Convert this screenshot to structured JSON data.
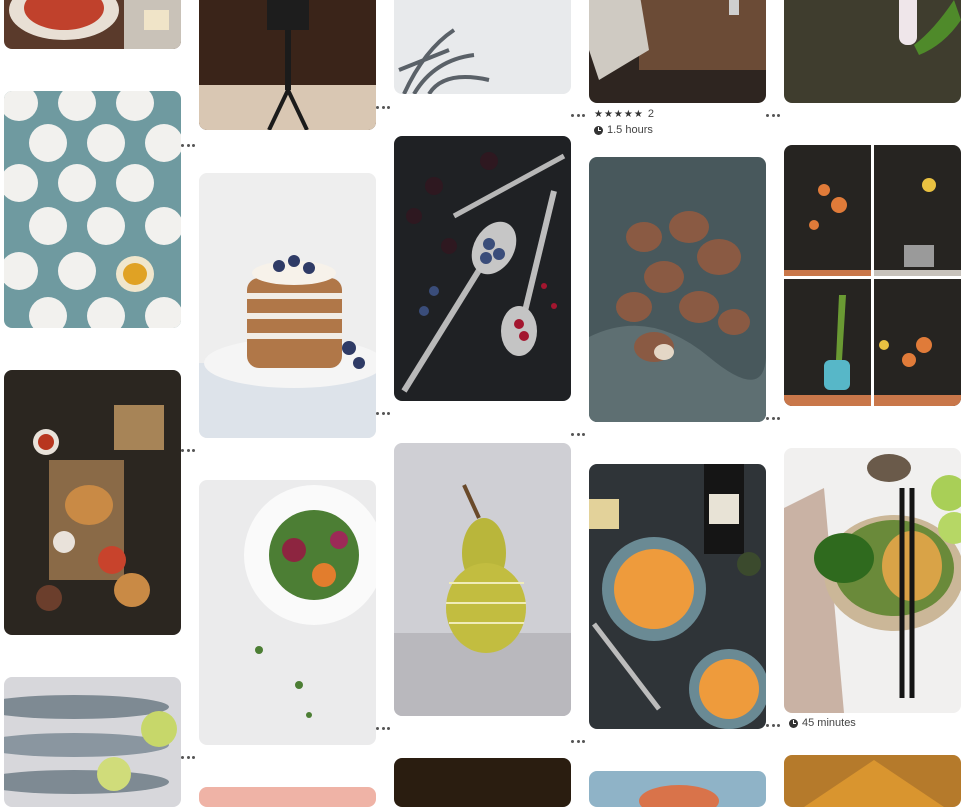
{
  "pins": [
    {
      "id": "p1",
      "name": "pasta-pin",
      "icon": "pasta-photo-icon"
    },
    {
      "id": "p2",
      "name": "eggs-pin",
      "icon": "eggs-photo-icon"
    },
    {
      "id": "p3",
      "name": "burger-pin",
      "icon": "burger-photo-icon"
    },
    {
      "id": "p4",
      "name": "fish-pin",
      "icon": "fish-photo-icon"
    },
    {
      "id": "p5",
      "name": "camera-pin",
      "icon": "camera-photo-icon"
    },
    {
      "id": "p6",
      "name": "pancakes-pin",
      "icon": "pancakes-photo-icon"
    },
    {
      "id": "p7",
      "name": "salad-pin",
      "icon": "salad-photo-icon"
    },
    {
      "id": "p8",
      "name": "plant-shadow-pin",
      "icon": "plant-shadow-photo-icon"
    },
    {
      "id": "p9",
      "name": "berries-spoons-pin",
      "icon": "berries-photo-icon"
    },
    {
      "id": "p10",
      "name": "pear-pin",
      "icon": "pear-photo-icon"
    },
    {
      "id": "p11",
      "name": "table-pin",
      "icon": "table-photo-icon"
    },
    {
      "id": "p12",
      "name": "mushrooms-pin",
      "icon": "mushrooms-photo-icon"
    },
    {
      "id": "p13",
      "name": "soup-pin",
      "icon": "soup-photo-icon"
    },
    {
      "id": "p14",
      "name": "herbs-pin",
      "icon": "herbs-photo-icon"
    },
    {
      "id": "p15",
      "name": "flying-food-pin",
      "icon": "flying-food-photo-icon"
    },
    {
      "id": "p16",
      "name": "noodles-pin",
      "icon": "noodles-photo-icon"
    }
  ],
  "table_pin": {
    "stars": "★★★★★",
    "rating_count": "2",
    "duration": "1.5 hours"
  },
  "noodles_pin": {
    "duration": "45 minutes"
  },
  "more_icon": "more-options-icon"
}
